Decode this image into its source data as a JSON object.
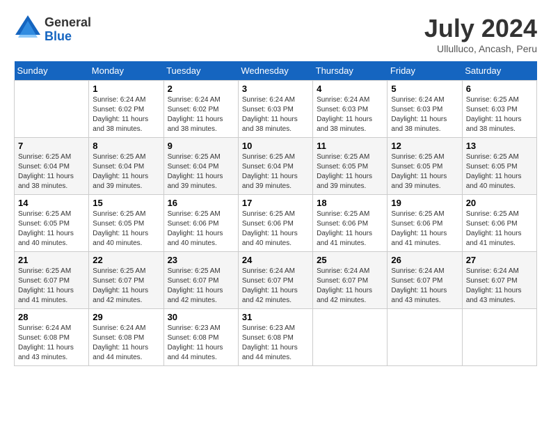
{
  "header": {
    "logo_general": "General",
    "logo_blue": "Blue",
    "month_year": "July 2024",
    "location": "Ullulluco, Ancash, Peru"
  },
  "days_of_week": [
    "Sunday",
    "Monday",
    "Tuesday",
    "Wednesday",
    "Thursday",
    "Friday",
    "Saturday"
  ],
  "weeks": [
    [
      {
        "day": "",
        "sunrise": "",
        "sunset": "",
        "daylight": ""
      },
      {
        "day": "1",
        "sunrise": "Sunrise: 6:24 AM",
        "sunset": "Sunset: 6:02 PM",
        "daylight": "Daylight: 11 hours and 38 minutes."
      },
      {
        "day": "2",
        "sunrise": "Sunrise: 6:24 AM",
        "sunset": "Sunset: 6:02 PM",
        "daylight": "Daylight: 11 hours and 38 minutes."
      },
      {
        "day": "3",
        "sunrise": "Sunrise: 6:24 AM",
        "sunset": "Sunset: 6:03 PM",
        "daylight": "Daylight: 11 hours and 38 minutes."
      },
      {
        "day": "4",
        "sunrise": "Sunrise: 6:24 AM",
        "sunset": "Sunset: 6:03 PM",
        "daylight": "Daylight: 11 hours and 38 minutes."
      },
      {
        "day": "5",
        "sunrise": "Sunrise: 6:24 AM",
        "sunset": "Sunset: 6:03 PM",
        "daylight": "Daylight: 11 hours and 38 minutes."
      },
      {
        "day": "6",
        "sunrise": "Sunrise: 6:25 AM",
        "sunset": "Sunset: 6:03 PM",
        "daylight": "Daylight: 11 hours and 38 minutes."
      }
    ],
    [
      {
        "day": "7",
        "sunrise": "Sunrise: 6:25 AM",
        "sunset": "Sunset: 6:04 PM",
        "daylight": "Daylight: 11 hours and 38 minutes."
      },
      {
        "day": "8",
        "sunrise": "Sunrise: 6:25 AM",
        "sunset": "Sunset: 6:04 PM",
        "daylight": "Daylight: 11 hours and 39 minutes."
      },
      {
        "day": "9",
        "sunrise": "Sunrise: 6:25 AM",
        "sunset": "Sunset: 6:04 PM",
        "daylight": "Daylight: 11 hours and 39 minutes."
      },
      {
        "day": "10",
        "sunrise": "Sunrise: 6:25 AM",
        "sunset": "Sunset: 6:04 PM",
        "daylight": "Daylight: 11 hours and 39 minutes."
      },
      {
        "day": "11",
        "sunrise": "Sunrise: 6:25 AM",
        "sunset": "Sunset: 6:05 PM",
        "daylight": "Daylight: 11 hours and 39 minutes."
      },
      {
        "day": "12",
        "sunrise": "Sunrise: 6:25 AM",
        "sunset": "Sunset: 6:05 PM",
        "daylight": "Daylight: 11 hours and 39 minutes."
      },
      {
        "day": "13",
        "sunrise": "Sunrise: 6:25 AM",
        "sunset": "Sunset: 6:05 PM",
        "daylight": "Daylight: 11 hours and 40 minutes."
      }
    ],
    [
      {
        "day": "14",
        "sunrise": "Sunrise: 6:25 AM",
        "sunset": "Sunset: 6:05 PM",
        "daylight": "Daylight: 11 hours and 40 minutes."
      },
      {
        "day": "15",
        "sunrise": "Sunrise: 6:25 AM",
        "sunset": "Sunset: 6:05 PM",
        "daylight": "Daylight: 11 hours and 40 minutes."
      },
      {
        "day": "16",
        "sunrise": "Sunrise: 6:25 AM",
        "sunset": "Sunset: 6:06 PM",
        "daylight": "Daylight: 11 hours and 40 minutes."
      },
      {
        "day": "17",
        "sunrise": "Sunrise: 6:25 AM",
        "sunset": "Sunset: 6:06 PM",
        "daylight": "Daylight: 11 hours and 40 minutes."
      },
      {
        "day": "18",
        "sunrise": "Sunrise: 6:25 AM",
        "sunset": "Sunset: 6:06 PM",
        "daylight": "Daylight: 11 hours and 41 minutes."
      },
      {
        "day": "19",
        "sunrise": "Sunrise: 6:25 AM",
        "sunset": "Sunset: 6:06 PM",
        "daylight": "Daylight: 11 hours and 41 minutes."
      },
      {
        "day": "20",
        "sunrise": "Sunrise: 6:25 AM",
        "sunset": "Sunset: 6:06 PM",
        "daylight": "Daylight: 11 hours and 41 minutes."
      }
    ],
    [
      {
        "day": "21",
        "sunrise": "Sunrise: 6:25 AM",
        "sunset": "Sunset: 6:07 PM",
        "daylight": "Daylight: 11 hours and 41 minutes."
      },
      {
        "day": "22",
        "sunrise": "Sunrise: 6:25 AM",
        "sunset": "Sunset: 6:07 PM",
        "daylight": "Daylight: 11 hours and 42 minutes."
      },
      {
        "day": "23",
        "sunrise": "Sunrise: 6:25 AM",
        "sunset": "Sunset: 6:07 PM",
        "daylight": "Daylight: 11 hours and 42 minutes."
      },
      {
        "day": "24",
        "sunrise": "Sunrise: 6:24 AM",
        "sunset": "Sunset: 6:07 PM",
        "daylight": "Daylight: 11 hours and 42 minutes."
      },
      {
        "day": "25",
        "sunrise": "Sunrise: 6:24 AM",
        "sunset": "Sunset: 6:07 PM",
        "daylight": "Daylight: 11 hours and 42 minutes."
      },
      {
        "day": "26",
        "sunrise": "Sunrise: 6:24 AM",
        "sunset": "Sunset: 6:07 PM",
        "daylight": "Daylight: 11 hours and 43 minutes."
      },
      {
        "day": "27",
        "sunrise": "Sunrise: 6:24 AM",
        "sunset": "Sunset: 6:07 PM",
        "daylight": "Daylight: 11 hours and 43 minutes."
      }
    ],
    [
      {
        "day": "28",
        "sunrise": "Sunrise: 6:24 AM",
        "sunset": "Sunset: 6:08 PM",
        "daylight": "Daylight: 11 hours and 43 minutes."
      },
      {
        "day": "29",
        "sunrise": "Sunrise: 6:24 AM",
        "sunset": "Sunset: 6:08 PM",
        "daylight": "Daylight: 11 hours and 44 minutes."
      },
      {
        "day": "30",
        "sunrise": "Sunrise: 6:23 AM",
        "sunset": "Sunset: 6:08 PM",
        "daylight": "Daylight: 11 hours and 44 minutes."
      },
      {
        "day": "31",
        "sunrise": "Sunrise: 6:23 AM",
        "sunset": "Sunset: 6:08 PM",
        "daylight": "Daylight: 11 hours and 44 minutes."
      },
      {
        "day": "",
        "sunrise": "",
        "sunset": "",
        "daylight": ""
      },
      {
        "day": "",
        "sunrise": "",
        "sunset": "",
        "daylight": ""
      },
      {
        "day": "",
        "sunrise": "",
        "sunset": "",
        "daylight": ""
      }
    ]
  ]
}
